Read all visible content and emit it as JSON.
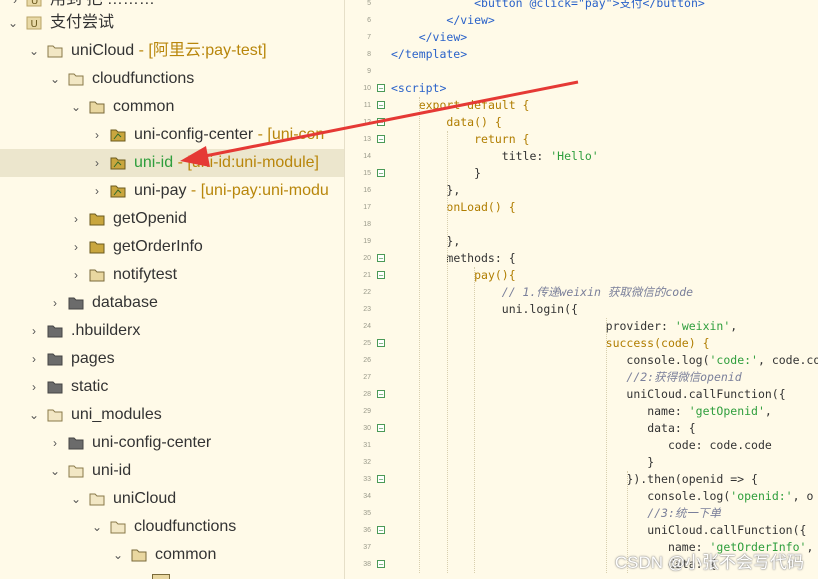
{
  "tree": {
    "nodes": [
      {
        "label": "用到 把 ………",
        "suffix": "",
        "indent": 0
      },
      {
        "label": "支付尝试",
        "suffix": "",
        "indent": 0
      },
      {
        "label": "uniCloud",
        "suffix": " - [阿里云:pay-test]",
        "indent": 1
      },
      {
        "label": "cloudfunctions",
        "suffix": "",
        "indent": 2
      },
      {
        "label": "common",
        "suffix": "",
        "indent": 3
      },
      {
        "label": "uni-config-center",
        "suffix": " - [uni-con",
        "indent": 4
      },
      {
        "label": "uni-id",
        "suffix": " - [uni-id:uni-module]",
        "indent": 4
      },
      {
        "label": "uni-pay",
        "suffix": " - [uni-pay:uni-modu",
        "indent": 4
      },
      {
        "label": "getOpenid",
        "suffix": "",
        "indent": 3
      },
      {
        "label": "getOrderInfo",
        "suffix": "",
        "indent": 3
      },
      {
        "label": "notifytest",
        "suffix": "",
        "indent": 3
      },
      {
        "label": "database",
        "suffix": "",
        "indent": 2
      },
      {
        "label": ".hbuilderx",
        "suffix": "",
        "indent": 1
      },
      {
        "label": "pages",
        "suffix": "",
        "indent": 1
      },
      {
        "label": "static",
        "suffix": "",
        "indent": 1
      },
      {
        "label": "uni_modules",
        "suffix": "",
        "indent": 1
      },
      {
        "label": "uni-config-center",
        "suffix": "",
        "indent": 2
      },
      {
        "label": "uni-id",
        "suffix": "",
        "indent": 2
      },
      {
        "label": "uniCloud",
        "suffix": "",
        "indent": 3
      },
      {
        "label": "cloudfunctions",
        "suffix": "",
        "indent": 4
      },
      {
        "label": "common",
        "suffix": "",
        "indent": 5
      }
    ]
  },
  "editor": {
    "lines": [
      {
        "n": "5",
        "code": "            <button @click=\"pay\">支付</button>"
      },
      {
        "n": "6",
        "code": "        </view>"
      },
      {
        "n": "7",
        "code": "    </view>"
      },
      {
        "n": "8",
        "code": "</template>"
      },
      {
        "n": "9",
        "code": ""
      },
      {
        "n": "10",
        "code": "<script>"
      },
      {
        "n": "11",
        "code": "    export default {"
      },
      {
        "n": "12",
        "code": "        data() {"
      },
      {
        "n": "13",
        "code": "            return {"
      },
      {
        "n": "14",
        "code": "                title: 'Hello'"
      },
      {
        "n": "15",
        "code": "            }"
      },
      {
        "n": "16",
        "code": "        },"
      },
      {
        "n": "17",
        "code": "        onLoad() {"
      },
      {
        "n": "18",
        "code": ""
      },
      {
        "n": "19",
        "code": "        },"
      },
      {
        "n": "20",
        "code": "        methods: {"
      },
      {
        "n": "21",
        "code": "            pay(){"
      },
      {
        "n": "22",
        "code": "                // 1.传递weixin 获取微信的code"
      },
      {
        "n": "23",
        "code": "                uni.login({"
      },
      {
        "n": "24",
        "code": "                               provider: 'weixin',"
      },
      {
        "n": "25",
        "code": "                               success(code) {"
      },
      {
        "n": "26",
        "code": "                                  console.log('code:', code.co"
      },
      {
        "n": "27",
        "code": "                                  //2:获得微信openid"
      },
      {
        "n": "28",
        "code": "                                  uniCloud.callFunction({"
      },
      {
        "n": "29",
        "code": "                                     name: 'getOpenid',"
      },
      {
        "n": "30",
        "code": "                                     data: {"
      },
      {
        "n": "31",
        "code": "                                        code: code.code"
      },
      {
        "n": "32",
        "code": "                                     }"
      },
      {
        "n": "33",
        "code": "                                  }).then(openid => {"
      },
      {
        "n": "34",
        "code": "                                     console.log('openid:', o"
      },
      {
        "n": "35",
        "code": "                                     //3:统一下单"
      },
      {
        "n": "36",
        "code": "                                     uniCloud.callFunction({"
      },
      {
        "n": "37",
        "code": "                                        name: 'getOrderInfo',"
      },
      {
        "n": "38",
        "code": "                                        data: {"
      }
    ]
  },
  "watermark": "CSDN @小张不会写代码",
  "colors": {
    "background": "#fffae8",
    "selected_row": "#ece6cd",
    "arrow": "#e53935",
    "green_text": "#2e9e3c",
    "suffix_text": "#b8860b"
  }
}
